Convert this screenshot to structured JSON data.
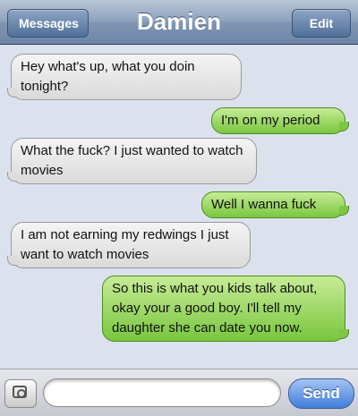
{
  "nav": {
    "back_label": "Messages",
    "title": "Damien",
    "edit_label": "Edit"
  },
  "messages": [
    {
      "side": "left",
      "text": "Hey what's up, what you doin tonight?"
    },
    {
      "side": "right",
      "text": "I'm on my period"
    },
    {
      "side": "left",
      "text": "What the fuck? I just wanted to watch movies"
    },
    {
      "side": "right",
      "text": "Well I wanna fuck"
    },
    {
      "side": "left",
      "text": "I am not earning my redwings I just want to watch movies"
    },
    {
      "side": "right",
      "text": "So this is what you kids talk about, okay your a good boy. I'll tell my daughter she can date you now."
    }
  ],
  "compose": {
    "input_value": "",
    "send_label": "Send",
    "camera_icon": "camera-icon"
  },
  "colors": {
    "incoming_bubble": "#e6e6e6",
    "outgoing_bubble": "#8fd14f",
    "send_button": "#3f7edb",
    "background": "#dbe2ed"
  }
}
